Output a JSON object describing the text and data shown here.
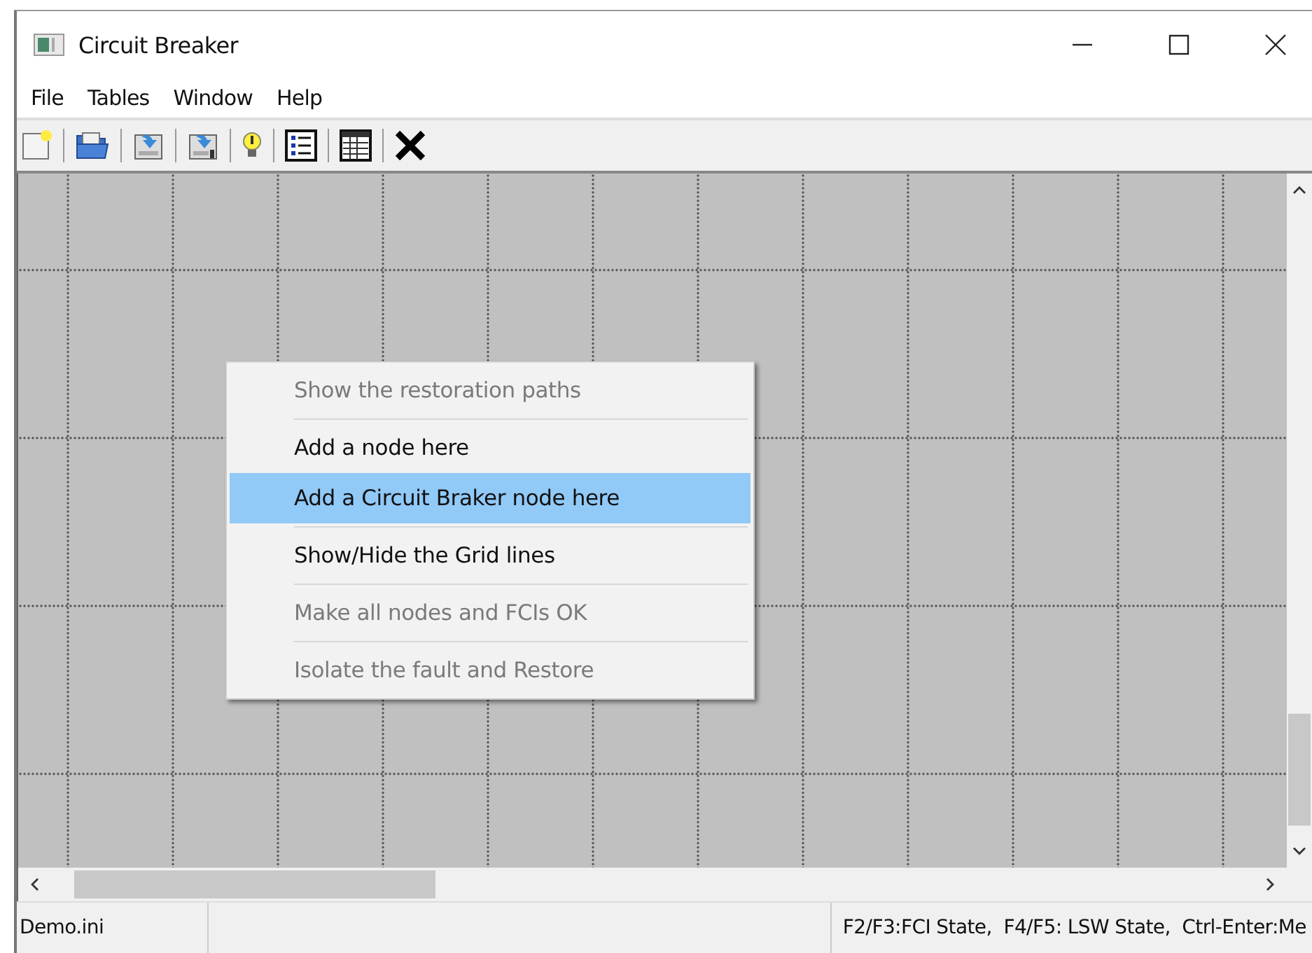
{
  "window": {
    "title": "Circuit Breaker"
  },
  "menu_bar": [
    "File",
    "Tables",
    "Window",
    "Help"
  ],
  "context_menu": [
    {
      "label": "Show the restoration paths",
      "disabled": true,
      "selected": false,
      "separator_after": true
    },
    {
      "label": "Add a node here",
      "disabled": false,
      "selected": false,
      "separator_after": false
    },
    {
      "label": "Add a Circuit Braker node here",
      "disabled": false,
      "selected": true,
      "separator_after": true
    },
    {
      "label": "Show/Hide the Grid lines",
      "disabled": false,
      "selected": false,
      "separator_after": true
    },
    {
      "label": "Make all nodes and FCIs OK",
      "disabled": true,
      "selected": false,
      "separator_after": true
    },
    {
      "label": "Isolate the fault and Restore",
      "disabled": true,
      "selected": false,
      "separator_after": false
    }
  ],
  "status_bar": {
    "file": "Demo.ini",
    "hint": "F2/F3:FCI State,  F4/F5: LSW State,  Ctrl-Enter:Me"
  }
}
